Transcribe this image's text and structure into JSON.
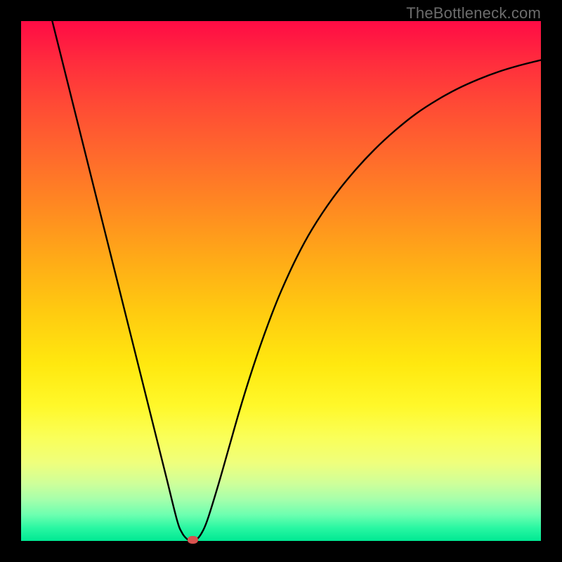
{
  "watermark": "TheBottleneck.com",
  "chart_data": {
    "type": "line",
    "title": "",
    "xlabel": "",
    "ylabel": "",
    "xlim": [
      0,
      100
    ],
    "ylim": [
      0,
      100
    ],
    "grid": false,
    "legend": false,
    "series": [
      {
        "name": "bottleneck-curve",
        "x": [
          6,
          8,
          10,
          12,
          14,
          16,
          18,
          20,
          22,
          24,
          26,
          28,
          30,
          31,
          32,
          33,
          34,
          35,
          36,
          38,
          40,
          42,
          44,
          46,
          48,
          50,
          53,
          56,
          60,
          64,
          68,
          72,
          76,
          80,
          84,
          88,
          92,
          96,
          100
        ],
        "y": [
          100,
          92,
          84,
          76,
          68,
          60,
          52,
          44,
          36,
          28,
          20,
          12,
          4,
          1.5,
          0.3,
          0.0,
          0.5,
          2,
          4.5,
          11,
          18,
          25,
          31.5,
          37.5,
          43,
          48,
          54.5,
          60,
          66,
          71,
          75.3,
          79,
          82.2,
          84.8,
          87,
          88.8,
          90.3,
          91.5,
          92.5
        ]
      }
    ],
    "annotations": [
      {
        "name": "minimum-marker",
        "x": 33,
        "y": 0
      }
    ],
    "colors": {
      "curve": "#000000",
      "marker": "#d9534f",
      "gradient_top": "#ff0b45",
      "gradient_bottom": "#00e893"
    }
  }
}
